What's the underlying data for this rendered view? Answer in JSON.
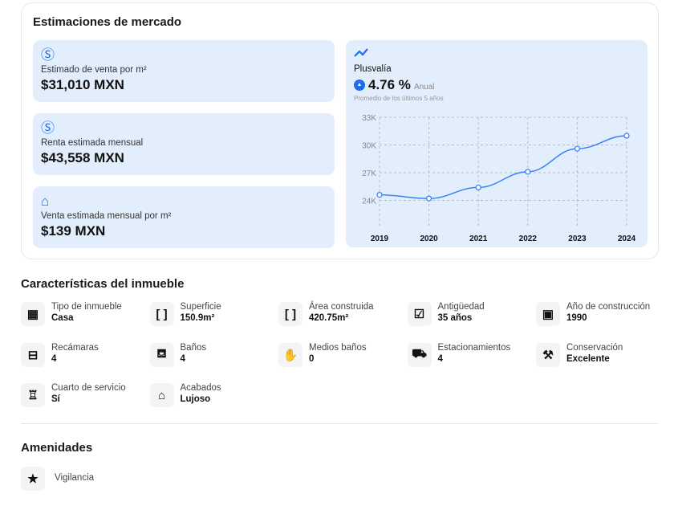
{
  "market": {
    "title": "Estimaciones de mercado",
    "cards": [
      {
        "icon": "dollar-circle-icon",
        "label": "Estimado de venta por m²",
        "value": "$31,010 MXN"
      },
      {
        "icon": "dollar-circle-icon",
        "label": "Renta estimada mensual",
        "value": "$43,558 MXN"
      },
      {
        "icon": "home-dollar-icon",
        "label": "Venta estimada mensual por m²",
        "value": "$139 MXN"
      }
    ],
    "plusvalia": {
      "label": "Plusvalía",
      "value": "4.76 %",
      "period": "Anual",
      "note": "Promedio de los últimos 5 años"
    }
  },
  "chart_data": {
    "type": "line",
    "x": [
      "2019",
      "2020",
      "2021",
      "2022",
      "2023",
      "2024"
    ],
    "values": [
      24600,
      24200,
      25400,
      27100,
      29600,
      31000
    ],
    "yticks": [
      "33K",
      "30K",
      "27K",
      "24K"
    ],
    "ytick_values": [
      33000,
      30000,
      27000,
      24000
    ],
    "ylim": [
      21000,
      33000
    ],
    "color": "#3b82f6",
    "grid": true
  },
  "features": {
    "title": "Características del inmueble",
    "items": [
      {
        "icon": "building-icon",
        "glyph": "▦",
        "label": "Tipo de inmueble",
        "value": "Casa"
      },
      {
        "icon": "surface-icon",
        "glyph": "[ ]",
        "label": "Superficie",
        "value": "150.9m²"
      },
      {
        "icon": "area-icon",
        "glyph": "[ ]",
        "label": "Área construida",
        "value": "420.75m²"
      },
      {
        "icon": "calendar-check-icon",
        "glyph": "☑",
        "label": "Antigüedad",
        "value": "35 años"
      },
      {
        "icon": "calendar-icon",
        "glyph": "▣",
        "label": "Año de construcción",
        "value": "1990"
      },
      {
        "icon": "bed-icon",
        "glyph": "⊟",
        "label": "Recámaras",
        "value": "4"
      },
      {
        "icon": "bathtub-icon",
        "glyph": "⛾",
        "label": "Baños",
        "value": "4"
      },
      {
        "icon": "wash-hand-icon",
        "glyph": "✋",
        "label": "Medios baños",
        "value": "0"
      },
      {
        "icon": "car-icon",
        "glyph": "⛟",
        "label": "Estacionamientos",
        "value": "4"
      },
      {
        "icon": "tools-icon",
        "glyph": "⚒",
        "label": "Conservación",
        "value": "Excelente"
      },
      {
        "icon": "broom-icon",
        "glyph": "♖",
        "label": "Cuarto de servicio",
        "value": "Sí"
      },
      {
        "icon": "house-icon",
        "glyph": "⌂",
        "label": "Acabados",
        "value": "Lujoso"
      }
    ]
  },
  "amenities": {
    "title": "Amenidades",
    "items": [
      {
        "icon": "shield-star-icon",
        "glyph": "★",
        "label": "Vigilancia"
      }
    ]
  }
}
